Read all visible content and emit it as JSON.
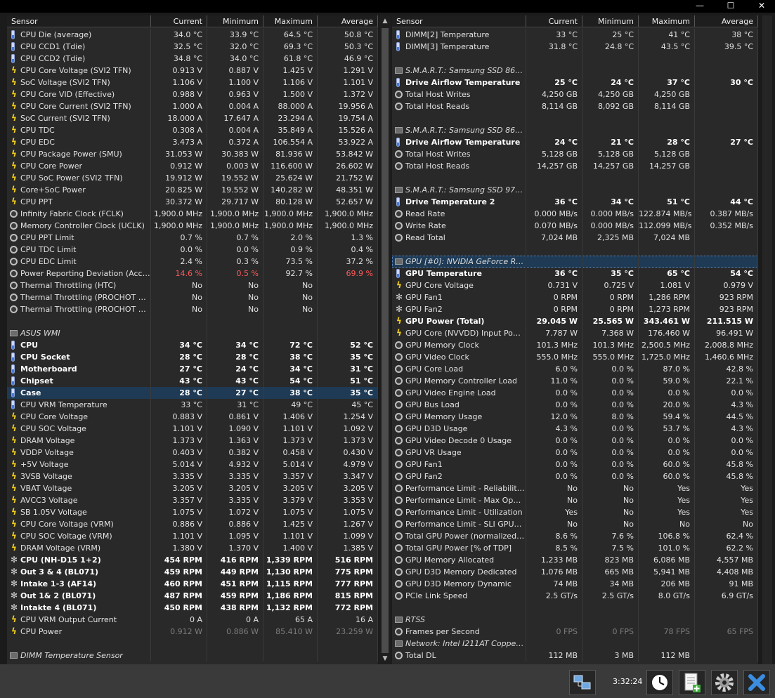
{
  "window": {
    "minimize": "—",
    "maximize": "☐",
    "close": "✕"
  },
  "left": {
    "headers": [
      "Sensor",
      "Current",
      "Minimum",
      "Maximum",
      "Average"
    ],
    "rows": [
      {
        "icon": "thermometer",
        "name": "CPU Die (average)",
        "cur": "34.0 °C",
        "min": "33.9 °C",
        "max": "64.5 °C",
        "avg": "50.8 °C"
      },
      {
        "icon": "thermometer",
        "name": "CPU CCD1 (Tdie)",
        "cur": "32.5 °C",
        "min": "32.0 °C",
        "max": "69.3 °C",
        "avg": "50.3 °C"
      },
      {
        "icon": "thermometer",
        "name": "CPU CCD2 (Tdie)",
        "cur": "34.8 °C",
        "min": "34.0 °C",
        "max": "61.8 °C",
        "avg": "46.9 °C"
      },
      {
        "icon": "bolt",
        "name": "CPU Core Voltage (SVI2 TFN)",
        "cur": "0.913 V",
        "min": "0.887 V",
        "max": "1.425 V",
        "avg": "1.291 V"
      },
      {
        "icon": "bolt",
        "name": "SoC Voltage (SVI2 TFN)",
        "cur": "1.106 V",
        "min": "1.100 V",
        "max": "1.106 V",
        "avg": "1.101 V"
      },
      {
        "icon": "bolt",
        "name": "CPU Core VID (Effective)",
        "cur": "0.988 V",
        "min": "0.963 V",
        "max": "1.500 V",
        "avg": "1.372 V"
      },
      {
        "icon": "bolt",
        "name": "CPU Core Current (SVI2 TFN)",
        "cur": "1.000 A",
        "min": "0.004 A",
        "max": "88.000 A",
        "avg": "19.956 A"
      },
      {
        "icon": "bolt",
        "name": "SoC Current (SVI2 TFN)",
        "cur": "18.000 A",
        "min": "17.647 A",
        "max": "23.294 A",
        "avg": "19.754 A"
      },
      {
        "icon": "bolt",
        "name": "CPU TDC",
        "cur": "0.308 A",
        "min": "0.004 A",
        "max": "35.849 A",
        "avg": "15.526 A"
      },
      {
        "icon": "bolt",
        "name": "CPU EDC",
        "cur": "3.473 A",
        "min": "0.372 A",
        "max": "106.554 A",
        "avg": "53.922 A"
      },
      {
        "icon": "bolt",
        "name": "CPU Package Power (SMU)",
        "cur": "31.053 W",
        "min": "30.383 W",
        "max": "81.936 W",
        "avg": "53.842 W"
      },
      {
        "icon": "bolt",
        "name": "CPU Core Power",
        "cur": "0.912 W",
        "min": "0.003 W",
        "max": "116.600 W",
        "avg": "26.602 W"
      },
      {
        "icon": "bolt",
        "name": "CPU SoC Power (SVI2 TFN)",
        "cur": "19.912 W",
        "min": "19.552 W",
        "max": "25.624 W",
        "avg": "21.752 W"
      },
      {
        "icon": "bolt",
        "name": "Core+SoC Power",
        "cur": "20.825 W",
        "min": "19.552 W",
        "max": "140.282 W",
        "avg": "48.351 W"
      },
      {
        "icon": "bolt",
        "name": "CPU PPT",
        "cur": "30.372 W",
        "min": "29.717 W",
        "max": "80.128 W",
        "avg": "52.657 W"
      },
      {
        "icon": "clock",
        "name": "Infinity Fabric Clock (FCLK)",
        "cur": "1,900.0 MHz",
        "min": "1,900.0 MHz",
        "max": "1,900.0 MHz",
        "avg": "1,900.0 MHz"
      },
      {
        "icon": "clock",
        "name": "Memory Controller Clock (UCLK)",
        "cur": "1,900.0 MHz",
        "min": "1,900.0 MHz",
        "max": "1,900.0 MHz",
        "avg": "1,900.0 MHz"
      },
      {
        "icon": "clock",
        "name": "CPU PPT Limit",
        "cur": "0.7 %",
        "min": "0.7 %",
        "max": "2.0 %",
        "avg": "1.3 %"
      },
      {
        "icon": "clock",
        "name": "CPU TDC Limit",
        "cur": "0.0 %",
        "min": "0.0 %",
        "max": "0.9 %",
        "avg": "0.4 %"
      },
      {
        "icon": "clock",
        "name": "CPU EDC Limit",
        "cur": "2.4 %",
        "min": "0.3 %",
        "max": "73.5 %",
        "avg": "37.2 %"
      },
      {
        "icon": "clock",
        "name": "Power Reporting Deviation (Accura...",
        "cur": "14.6 %",
        "min": "0.5 %",
        "max": "92.7 %",
        "avg": "69.9 %",
        "red": [
          "cur",
          "min",
          "avg"
        ]
      },
      {
        "icon": "clock",
        "name": "Thermal Throttling (HTC)",
        "cur": "No",
        "min": "No",
        "max": "No",
        "avg": ""
      },
      {
        "icon": "clock",
        "name": "Thermal Throttling (PROCHOT CPU)",
        "cur": "No",
        "min": "No",
        "max": "No",
        "avg": ""
      },
      {
        "icon": "clock",
        "name": "Thermal Throttling (PROCHOT EXT)",
        "cur": "No",
        "min": "No",
        "max": "No",
        "avg": ""
      },
      {
        "icon": "none",
        "name": "",
        "cur": "",
        "min": "",
        "max": "",
        "avg": ""
      },
      {
        "icon": "chip",
        "group": true,
        "name": "ASUS WMI",
        "cur": "",
        "min": "",
        "max": "",
        "avg": ""
      },
      {
        "icon": "thermometer",
        "bold": true,
        "name": "CPU",
        "cur": "34 °C",
        "min": "34 °C",
        "max": "72 °C",
        "avg": "52 °C"
      },
      {
        "icon": "thermometer",
        "bold": true,
        "name": "CPU Socket",
        "cur": "28 °C",
        "min": "28 °C",
        "max": "38 °C",
        "avg": "35 °C"
      },
      {
        "icon": "thermometer",
        "bold": true,
        "name": "Motherboard",
        "cur": "27 °C",
        "min": "24 °C",
        "max": "34 °C",
        "avg": "31 °C"
      },
      {
        "icon": "thermometer",
        "bold": true,
        "name": "Chipset",
        "cur": "43 °C",
        "min": "43 °C",
        "max": "54 °C",
        "avg": "51 °C"
      },
      {
        "icon": "thermometer",
        "bold": true,
        "selected": true,
        "name": "Case",
        "cur": "28 °C",
        "min": "27 °C",
        "max": "38 °C",
        "avg": "35 °C"
      },
      {
        "icon": "thermometer",
        "name": "CPU VRM Temperature",
        "cur": "33 °C",
        "min": "31 °C",
        "max": "49 °C",
        "avg": "45 °C"
      },
      {
        "icon": "bolt",
        "name": "CPU Core Voltage",
        "cur": "0.883 V",
        "min": "0.861 V",
        "max": "1.406 V",
        "avg": "1.254 V"
      },
      {
        "icon": "bolt",
        "name": "CPU SOC Voltage",
        "cur": "1.101 V",
        "min": "1.090 V",
        "max": "1.101 V",
        "avg": "1.092 V"
      },
      {
        "icon": "bolt",
        "name": "DRAM Voltage",
        "cur": "1.373 V",
        "min": "1.363 V",
        "max": "1.373 V",
        "avg": "1.373 V"
      },
      {
        "icon": "bolt",
        "name": "VDDP Voltage",
        "cur": "0.403 V",
        "min": "0.382 V",
        "max": "0.458 V",
        "avg": "0.430 V"
      },
      {
        "icon": "bolt",
        "name": "+5V Voltage",
        "cur": "5.014 V",
        "min": "4.932 V",
        "max": "5.014 V",
        "avg": "4.979 V"
      },
      {
        "icon": "bolt",
        "name": "3VSB Voltage",
        "cur": "3.335 V",
        "min": "3.335 V",
        "max": "3.357 V",
        "avg": "3.347 V"
      },
      {
        "icon": "bolt",
        "name": "VBAT Voltage",
        "cur": "3.205 V",
        "min": "3.205 V",
        "max": "3.205 V",
        "avg": "3.205 V"
      },
      {
        "icon": "bolt",
        "name": "AVCC3 Voltage",
        "cur": "3.357 V",
        "min": "3.335 V",
        "max": "3.379 V",
        "avg": "3.353 V"
      },
      {
        "icon": "bolt",
        "name": "SB 1.05V Voltage",
        "cur": "1.075 V",
        "min": "1.072 V",
        "max": "1.075 V",
        "avg": "1.075 V"
      },
      {
        "icon": "bolt",
        "name": "CPU Core Voltage (VRM)",
        "cur": "0.886 V",
        "min": "0.886 V",
        "max": "1.425 V",
        "avg": "1.267 V"
      },
      {
        "icon": "bolt",
        "name": "CPU SOC Voltage (VRM)",
        "cur": "1.101 V",
        "min": "1.095 V",
        "max": "1.101 V",
        "avg": "1.099 V"
      },
      {
        "icon": "bolt",
        "name": "DRAM Voltage (VRM)",
        "cur": "1.380 V",
        "min": "1.370 V",
        "max": "1.400 V",
        "avg": "1.385 V"
      },
      {
        "icon": "fan",
        "bold": true,
        "name": "CPU (NH-D15 1+2)",
        "cur": "454 RPM",
        "min": "416 RPM",
        "max": "1,339 RPM",
        "avg": "516 RPM"
      },
      {
        "icon": "fan",
        "bold": true,
        "name": "Out 3 & 4 (BL071)",
        "cur": "459 RPM",
        "min": "449 RPM",
        "max": "1,130 RPM",
        "avg": "775 RPM"
      },
      {
        "icon": "fan",
        "bold": true,
        "name": "Intake 1-3 (AF14)",
        "cur": "460 RPM",
        "min": "451 RPM",
        "max": "1,115 RPM",
        "avg": "777 RPM"
      },
      {
        "icon": "fan",
        "bold": true,
        "name": "Out 1& 2 (BL071)",
        "cur": "487 RPM",
        "min": "459 RPM",
        "max": "1,186 RPM",
        "avg": "815 RPM"
      },
      {
        "icon": "fan",
        "bold": true,
        "name": "Intakte 4 (BL071)",
        "cur": "450 RPM",
        "min": "438 RPM",
        "max": "1,132 RPM",
        "avg": "772 RPM"
      },
      {
        "icon": "bolt",
        "name": "CPU VRM Output Current",
        "cur": "0 A",
        "min": "0 A",
        "max": "65 A",
        "avg": "16 A"
      },
      {
        "icon": "bolt",
        "name": "CPU Power",
        "cur": "0.912 W",
        "min": "0.886 W",
        "max": "85.410 W",
        "avg": "23.259 W",
        "dim": true
      },
      {
        "icon": "none",
        "name": "",
        "cur": "",
        "min": "",
        "max": "",
        "avg": ""
      },
      {
        "icon": "chip",
        "group": true,
        "name": "DIMM Temperature Sensor",
        "cur": "",
        "min": "",
        "max": "",
        "avg": ""
      }
    ]
  },
  "right": {
    "headers": [
      "Sensor",
      "Current",
      "Minimum",
      "Maximum",
      "Average"
    ],
    "rows": [
      {
        "icon": "thermometer",
        "name": "DIMM[2] Temperature",
        "cur": "33 °C",
        "min": "25 °C",
        "max": "41 °C",
        "avg": "38 °C"
      },
      {
        "icon": "thermometer",
        "name": "DIMM[3] Temperature",
        "cur": "31.8 °C",
        "min": "24.8 °C",
        "max": "43.5 °C",
        "avg": "39.5 °C"
      },
      {
        "icon": "none",
        "name": "",
        "cur": "",
        "min": "",
        "max": "",
        "avg": ""
      },
      {
        "icon": "chip",
        "group": true,
        "name": "S.M.A.R.T.: Samsung SSD 860 ...",
        "cur": "",
        "min": "",
        "max": "",
        "avg": ""
      },
      {
        "icon": "thermometer",
        "bold": true,
        "name": "Drive Airflow Temperature",
        "cur": "25 °C",
        "min": "24 °C",
        "max": "37 °C",
        "avg": "30 °C"
      },
      {
        "icon": "clock",
        "name": "Total Host Writes",
        "cur": "4,250 GB",
        "min": "4,250 GB",
        "max": "4,250 GB",
        "avg": ""
      },
      {
        "icon": "clock",
        "name": "Total Host Reads",
        "cur": "8,114 GB",
        "min": "8,092 GB",
        "max": "8,114 GB",
        "avg": ""
      },
      {
        "icon": "none",
        "name": "",
        "cur": "",
        "min": "",
        "max": "",
        "avg": ""
      },
      {
        "icon": "chip",
        "group": true,
        "name": "S.M.A.R.T.: Samsung SSD 860 ...",
        "cur": "",
        "min": "",
        "max": "",
        "avg": ""
      },
      {
        "icon": "thermometer",
        "bold": true,
        "name": "Drive Airflow Temperature",
        "cur": "24 °C",
        "min": "21 °C",
        "max": "28 °C",
        "avg": "27 °C"
      },
      {
        "icon": "clock",
        "name": "Total Host Writes",
        "cur": "5,128 GB",
        "min": "5,128 GB",
        "max": "5,128 GB",
        "avg": ""
      },
      {
        "icon": "clock",
        "name": "Total Host Reads",
        "cur": "14,257 GB",
        "min": "14,257 GB",
        "max": "14,257 GB",
        "avg": ""
      },
      {
        "icon": "none",
        "name": "",
        "cur": "",
        "min": "",
        "max": "",
        "avg": ""
      },
      {
        "icon": "chip",
        "group": true,
        "name": "S.M.A.R.T.: Samsung SSD 970 ...",
        "cur": "",
        "min": "",
        "max": "",
        "avg": ""
      },
      {
        "icon": "thermometer",
        "bold": true,
        "name": "Drive Temperature 2",
        "cur": "36 °C",
        "min": "34 °C",
        "max": "51 °C",
        "avg": "44 °C"
      },
      {
        "icon": "clock",
        "name": "Read Rate",
        "cur": "0.000 MB/s",
        "min": "0.000 MB/s",
        "max": "122.874 MB/s",
        "avg": "0.387 MB/s"
      },
      {
        "icon": "clock",
        "name": "Write Rate",
        "cur": "0.070 MB/s",
        "min": "0.000 MB/s",
        "max": "112.099 MB/s",
        "avg": "0.352 MB/s"
      },
      {
        "icon": "clock",
        "name": "Read Total",
        "cur": "7,024 MB",
        "min": "2,325 MB",
        "max": "7,024 MB",
        "avg": ""
      },
      {
        "icon": "none",
        "name": "",
        "cur": "",
        "min": "",
        "max": "",
        "avg": ""
      },
      {
        "icon": "chip",
        "group": true,
        "groupsel": true,
        "name": "GPU [#0]: NVIDIA GeForce RTX ...",
        "cur": "",
        "min": "",
        "max": "",
        "avg": ""
      },
      {
        "icon": "thermometer",
        "bold": true,
        "name": "GPU Temperature",
        "cur": "36 °C",
        "min": "35 °C",
        "max": "65 °C",
        "avg": "54 °C"
      },
      {
        "icon": "bolt",
        "name": "GPU Core Voltage",
        "cur": "0.731 V",
        "min": "0.725 V",
        "max": "1.081 V",
        "avg": "0.979 V"
      },
      {
        "icon": "fan",
        "name": "GPU Fan1",
        "cur": "0 RPM",
        "min": "0 RPM",
        "max": "1,286 RPM",
        "avg": "923 RPM"
      },
      {
        "icon": "fan",
        "name": "GPU Fan2",
        "cur": "0 RPM",
        "min": "0 RPM",
        "max": "1,273 RPM",
        "avg": "923 RPM"
      },
      {
        "icon": "bolt",
        "bold": true,
        "name": "GPU Power (Total)",
        "cur": "29.045 W",
        "min": "25.565 W",
        "max": "343.461 W",
        "avg": "211.515 W",
        "red": [
          "max"
        ]
      },
      {
        "icon": "bolt",
        "name": "GPU Core (NVVDD) Input Power ...",
        "cur": "7.787 W",
        "min": "7.368 W",
        "max": "176.460 W",
        "avg": "96.491 W"
      },
      {
        "icon": "clock",
        "name": "GPU Memory Clock",
        "cur": "101.3 MHz",
        "min": "101.3 MHz",
        "max": "2,500.5 MHz",
        "avg": "2,008.8 MHz"
      },
      {
        "icon": "clock",
        "name": "GPU Video Clock",
        "cur": "555.0 MHz",
        "min": "555.0 MHz",
        "max": "1,725.0 MHz",
        "avg": "1,460.6 MHz"
      },
      {
        "icon": "clock",
        "name": "GPU Core Load",
        "cur": "6.0 %",
        "min": "0.0 %",
        "max": "87.0 %",
        "avg": "42.8 %"
      },
      {
        "icon": "clock",
        "name": "GPU Memory Controller Load",
        "cur": "11.0 %",
        "min": "0.0 %",
        "max": "59.0 %",
        "avg": "22.1 %"
      },
      {
        "icon": "clock",
        "name": "GPU Video Engine Load",
        "cur": "0.0 %",
        "min": "0.0 %",
        "max": "0.0 %",
        "avg": "0.0 %"
      },
      {
        "icon": "clock",
        "name": "GPU Bus Load",
        "cur": "0.0 %",
        "min": "0.0 %",
        "max": "20.0 %",
        "avg": "4.3 %"
      },
      {
        "icon": "clock",
        "name": "GPU Memory Usage",
        "cur": "12.0 %",
        "min": "8.0 %",
        "max": "59.4 %",
        "avg": "44.5 %"
      },
      {
        "icon": "clock",
        "name": "GPU D3D Usage",
        "cur": "4.3 %",
        "min": "0.0 %",
        "max": "53.7 %",
        "avg": "4.3 %"
      },
      {
        "icon": "clock",
        "name": "GPU Video Decode 0 Usage",
        "cur": "0.0 %",
        "min": "0.0 %",
        "max": "0.0 %",
        "avg": "0.0 %"
      },
      {
        "icon": "clock",
        "name": "GPU VR Usage",
        "cur": "0.0 %",
        "min": "0.0 %",
        "max": "0.0 %",
        "avg": "0.0 %"
      },
      {
        "icon": "clock",
        "name": "GPU Fan1",
        "cur": "0.0 %",
        "min": "0.0 %",
        "max": "60.0 %",
        "avg": "45.8 %"
      },
      {
        "icon": "clock",
        "name": "GPU Fan2",
        "cur": "0.0 %",
        "min": "0.0 %",
        "max": "60.0 %",
        "avg": "45.8 %"
      },
      {
        "icon": "clock",
        "name": "Performance Limit - Reliability Vo...",
        "cur": "No",
        "min": "No",
        "max": "Yes",
        "avg": "Yes"
      },
      {
        "icon": "clock",
        "name": "Performance Limit - Max Operati...",
        "cur": "No",
        "min": "No",
        "max": "Yes",
        "avg": "Yes"
      },
      {
        "icon": "clock",
        "name": "Performance Limit - Utilization",
        "cur": "Yes",
        "min": "No",
        "max": "Yes",
        "avg": "Yes"
      },
      {
        "icon": "clock",
        "name": "Performance Limit - SLI GPUBoo...",
        "cur": "No",
        "min": "No",
        "max": "No",
        "avg": "No"
      },
      {
        "icon": "clock",
        "name": "Total GPU Power (normalized) [...",
        "cur": "8.6 %",
        "min": "7.6 %",
        "max": "106.8 %",
        "avg": "62.4 %"
      },
      {
        "icon": "clock",
        "name": "Total GPU Power [% of TDP]",
        "cur": "8.5 %",
        "min": "7.5 %",
        "max": "101.0 %",
        "avg": "62.2 %"
      },
      {
        "icon": "clock",
        "name": "GPU Memory Allocated",
        "cur": "1,233 MB",
        "min": "823 MB",
        "max": "6,086 MB",
        "avg": "4,557 MB"
      },
      {
        "icon": "clock",
        "name": "GPU D3D Memory Dedicated",
        "cur": "1,076 MB",
        "min": "665 MB",
        "max": "5,941 MB",
        "avg": "4,408 MB"
      },
      {
        "icon": "clock",
        "name": "GPU D3D Memory Dynamic",
        "cur": "74 MB",
        "min": "34 MB",
        "max": "206 MB",
        "avg": "91 MB"
      },
      {
        "icon": "clock",
        "name": "PCIe Link Speed",
        "cur": "2.5 GT/s",
        "min": "2.5 GT/s",
        "max": "8.0 GT/s",
        "avg": "6.9 GT/s"
      },
      {
        "icon": "none",
        "name": "",
        "cur": "",
        "min": "",
        "max": "",
        "avg": ""
      },
      {
        "icon": "chip",
        "group": true,
        "name": "RTSS",
        "cur": "",
        "min": "",
        "max": "",
        "avg": ""
      },
      {
        "icon": "clock",
        "name": "Frames per Second",
        "cur": "0 FPS",
        "min": "0 FPS",
        "max": "78 FPS",
        "avg": "65 FPS",
        "dim": true
      },
      {
        "icon": "chip",
        "group": true,
        "name": "Network: Intel I211AT Copper (...",
        "cur": "",
        "min": "",
        "max": "",
        "avg": ""
      },
      {
        "icon": "clock",
        "name": "Total DL",
        "cur": "112 MB",
        "min": "3 MB",
        "max": "112 MB",
        "avg": ""
      }
    ]
  },
  "toolbar": {
    "time": "3:32:24"
  }
}
